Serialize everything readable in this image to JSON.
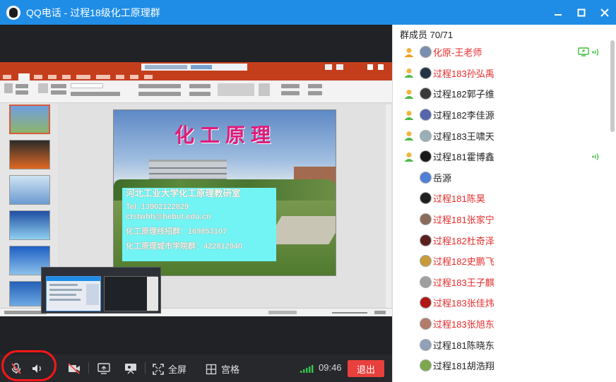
{
  "window": {
    "title": "QQ电话 - 过程18级化工原理群"
  },
  "slide": {
    "heading": "化工原理",
    "lines": [
      "河北工业大学化工原理教研室",
      "Tel: 13902122829",
      "ctstwhh@hebut.edu.cn",
      "化工原理线招群：169853107",
      "化工原理城市学院群：422812940"
    ]
  },
  "members": {
    "header": "群成员 70/71",
    "items": [
      {
        "name": "化原-王老师",
        "color": "red",
        "role": "host",
        "sharing": true,
        "speaking": true,
        "avatar": "#7a8fb0"
      },
      {
        "name": "过程183孙弘禹",
        "color": "red",
        "role": "user",
        "avatar": "#223344"
      },
      {
        "name": "过程182郭子维",
        "color": "dark",
        "role": "user",
        "avatar": "#3a3a3a"
      },
      {
        "name": "过程182李佳源",
        "color": "dark",
        "role": "user",
        "avatar": "#5566aa"
      },
      {
        "name": "过程183王啸天",
        "color": "dark",
        "role": "user",
        "avatar": "#9ab0b8"
      },
      {
        "name": "过程181霍博鑫",
        "color": "dark",
        "role": "user",
        "speaking": true,
        "avatar": "#1a1a1a"
      },
      {
        "name": "岳源",
        "color": "dark",
        "role": "none",
        "avatar": "#4f7fd8"
      },
      {
        "name": "过程181陈昊",
        "color": "red",
        "role": "none",
        "avatar": "#1f1f1f"
      },
      {
        "name": "过程181张家宁",
        "color": "red",
        "role": "none",
        "avatar": "#8a6a5a"
      },
      {
        "name": "过程182杜奇泽",
        "color": "red",
        "role": "none",
        "avatar": "#5a2020"
      },
      {
        "name": "过程182史鹏飞",
        "color": "red",
        "role": "none",
        "avatar": "#c79a3b"
      },
      {
        "name": "过程183王子麒",
        "color": "red",
        "role": "none",
        "avatar": "#9f9f9f"
      },
      {
        "name": "过程183张佳炜",
        "color": "red",
        "role": "none",
        "avatar": "#b01818"
      },
      {
        "name": "过程183张旭东",
        "color": "red",
        "role": "none",
        "avatar": "#b27b6a"
      },
      {
        "name": "过程181陈晓东",
        "color": "dark",
        "role": "none",
        "avatar": "#8fa0b8"
      },
      {
        "name": "过程181胡浩翔",
        "color": "dark",
        "role": "none",
        "avatar": "#7aa84a"
      }
    ]
  },
  "controls": {
    "fullscreen_label": "全屏",
    "grid_label": "宫格",
    "time": "09:46",
    "exit_label": "退出"
  },
  "colors": {
    "titlebar": "#1f8de6",
    "exit": "#e8403c",
    "member_red": "#e52b2b",
    "speaking": "#3cbf3c",
    "annotation_ring": "#ff1616"
  },
  "icons": [
    "app-logo-icon",
    "minimize-icon",
    "maximize-icon",
    "close-icon",
    "user-icon",
    "screen-share-icon",
    "speaking-icon",
    "mic-muted-icon",
    "speaker-icon",
    "camera-off-icon",
    "share-screen-icon",
    "presentation-icon",
    "fullscreen-icon",
    "grid-icon",
    "signal-icon"
  ]
}
